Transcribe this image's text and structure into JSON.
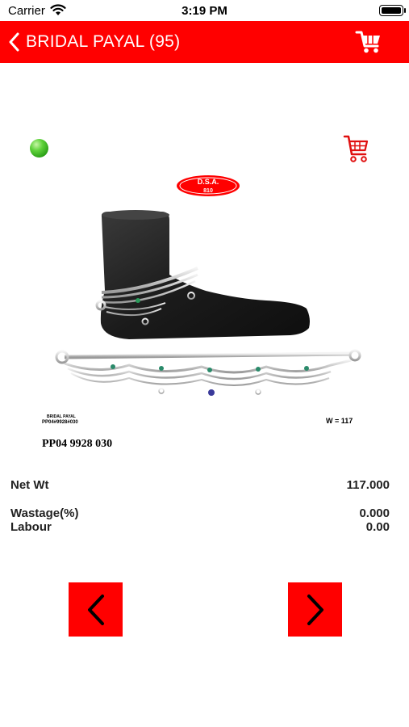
{
  "status_bar": {
    "carrier": "Carrier",
    "time": "3:19 PM"
  },
  "nav": {
    "title": "BRIDAL PAYAL (95)",
    "back_icon": "chevron-left-icon",
    "cart_icon": "cart-icon"
  },
  "product": {
    "brand_badge_line1": "D.S.A.",
    "brand_badge_line2": "810",
    "image_category": "BRIDAL PAYAL",
    "image_code": "PP04#9928#030",
    "image_weight": "W = 117",
    "design_number": "PP04 9928 030",
    "stock_status_color": "#3cbf22"
  },
  "details": {
    "net_wt_label": "Net Wt",
    "net_wt_value": "117.000",
    "wastage_label": "Wastage(%)",
    "wastage_value": "0.000",
    "labour_label": "Labour",
    "labour_value": "0.00"
  },
  "colors": {
    "accent": "#ff0000",
    "header_text": "#ffffff"
  }
}
